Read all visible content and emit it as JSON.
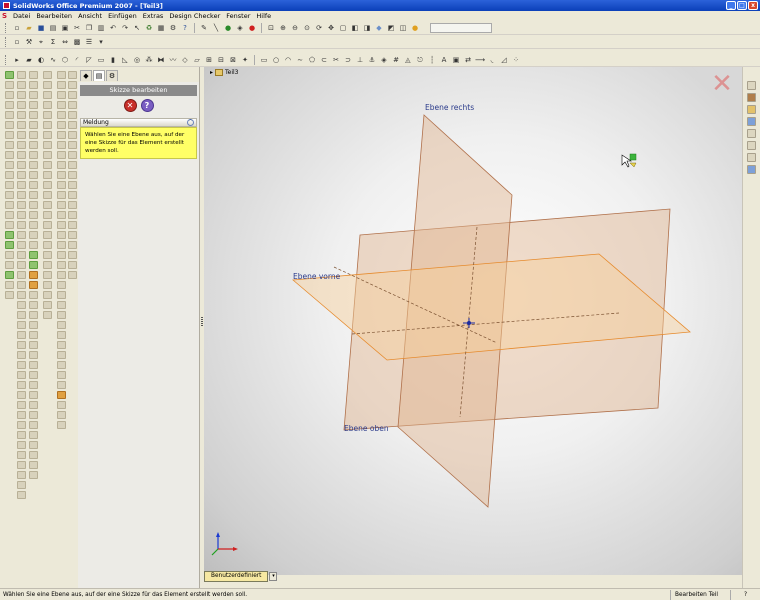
{
  "window": {
    "title": "SolidWorks Office Premium 2007 - [Teil3]",
    "controls": [
      "minimize",
      "restore",
      "close"
    ]
  },
  "menu": {
    "items": [
      "Datei",
      "Bearbeiten",
      "Ansicht",
      "Einfügen",
      "Extras",
      "Design Checker",
      "Fenster",
      "Hilfe"
    ]
  },
  "toolbars": {
    "row1_icons": [
      "new-icon",
      "open-icon",
      "save-icon",
      "print-icon",
      "undo-icon",
      "redo-icon",
      "select-icon",
      "rebuild-icon",
      "options-icon"
    ],
    "row1_view_icons": [
      "zoom-fit-icon",
      "zoom-area-icon",
      "zoom-in-out-icon",
      "rotate-icon",
      "pan-icon",
      "standard-views-icon",
      "display-style-icon",
      "appearance-icon"
    ],
    "combo_value": ""
  },
  "feature_manager": {
    "tabs": [
      "feature-tree",
      "property-manager",
      "configuration-manager"
    ],
    "panel_title": "Skizze bearbeiten",
    "message_heading": "Meldung",
    "message_text": "Wählen Sie eine Ebene aus, auf der eine Skizze für das Element erstellt werden soll."
  },
  "viewport": {
    "tree_node_label": "Teil3",
    "planes": {
      "right": "Ebene rechts",
      "front": "Ebene vorne",
      "top": "Ebene oben"
    },
    "plane_colors": {
      "side": "#e0b48e",
      "top": "#f7cf98",
      "edge": "#b0704a",
      "top_edge": "#e68a2c"
    }
  },
  "view_tab": {
    "label": "Benutzerdefiniert"
  },
  "status": {
    "message": "Wählen Sie eine Ebene aus, auf der eine Skizze für das Element erstellt werden soll.",
    "mode": "Bearbeiten Teil",
    "help_icon": "help-icon"
  }
}
